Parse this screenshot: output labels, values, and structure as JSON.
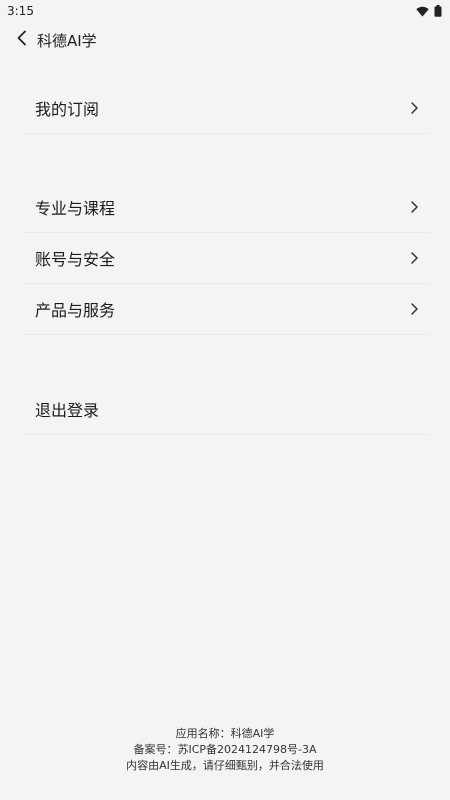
{
  "status_bar": {
    "time": "3:15",
    "icons": [
      "wifi-icon",
      "battery-icon"
    ]
  },
  "header": {
    "back_icon": "chevron-left-icon",
    "title": "科德AI学"
  },
  "menu": {
    "group1": [
      {
        "label": "我的订阅",
        "icon": "chevron-right-icon"
      }
    ],
    "group2": [
      {
        "label": "专业与课程",
        "icon": "chevron-right-icon"
      },
      {
        "label": "账号与安全",
        "icon": "chevron-right-icon"
      },
      {
        "label": "产品与服务",
        "icon": "chevron-right-icon"
      }
    ],
    "group3": [
      {
        "label": "退出登录"
      }
    ]
  },
  "footer": {
    "app_name": "应用名称：科德AI学",
    "icp": "备案号：苏ICP备2024124798号-3A",
    "disclaimer": "内容由AI生成，请仔细甄别，并合法使用"
  },
  "colors": {
    "background": "#f4f4f4",
    "divider": "#ebebeb",
    "text": "#1c1c1c"
  }
}
